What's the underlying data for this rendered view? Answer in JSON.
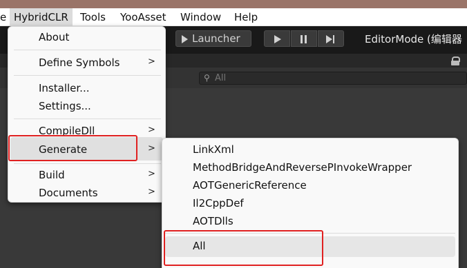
{
  "menubar": {
    "items": [
      "e",
      "HybridCLR",
      "Tools",
      "YooAsset",
      "Window",
      "Help"
    ]
  },
  "toolbar": {
    "launcher_label": "Launcher",
    "mode_label": "EditorMode (编辑器"
  },
  "search": {
    "placeholder": "All"
  },
  "hybridclr_menu": {
    "about": "About",
    "define_symbols": "Define Symbols",
    "installer": "Installer...",
    "settings": "Settings...",
    "compile_dll": "CompileDll",
    "generate": "Generate",
    "build": "Build",
    "documents": "Documents",
    "submenu_arrow": ">"
  },
  "generate_submenu": {
    "items": [
      "LinkXml",
      "MethodBridgeAndReversePInvokeWrapper",
      "AOTGenericReference",
      "Il2CppDef",
      "AOTDlls"
    ],
    "all": "All"
  },
  "colors": {
    "highlight_box": "#e02020",
    "toolbar_bg": "#191919",
    "menu_bg": "#f9f9f9"
  }
}
